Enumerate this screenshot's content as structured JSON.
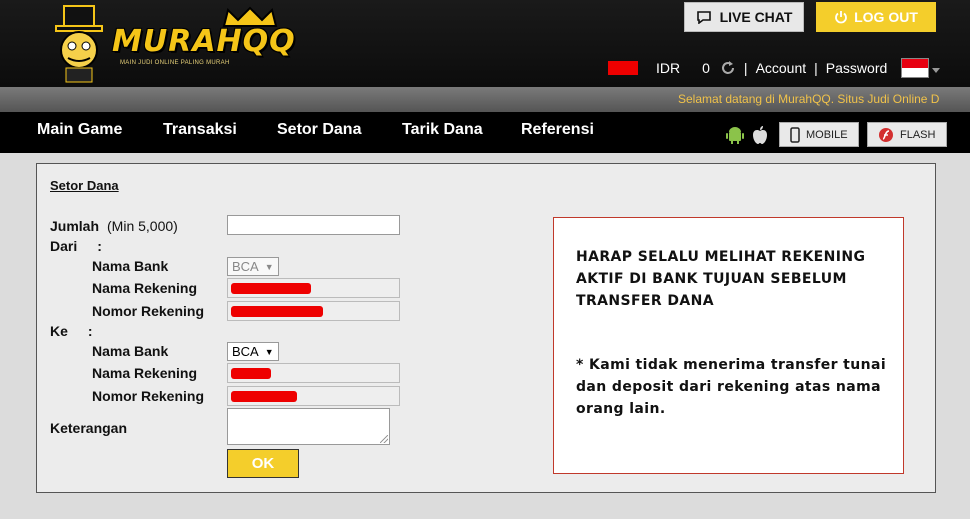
{
  "header": {
    "logo_text": "MURAHQQ",
    "logo_tagline": "MAIN JUDI ONLINE PALING MURAH",
    "live_chat_label": "LIVE CHAT",
    "logout_label": "LOG OUT",
    "currency": "IDR",
    "balance": "0",
    "account_link": "Account",
    "password_link": "Password",
    "separator": "|"
  },
  "marquee": {
    "text": "Selamat datang di MurahQQ. Situs Judi Online D"
  },
  "nav": {
    "items": [
      "Main Game",
      "Transaksi",
      "Setor Dana",
      "Tarik Dana",
      "Referensi"
    ],
    "mobile_label": "MOBILE",
    "flash_label": "FLASH"
  },
  "form": {
    "title": "Setor Dana",
    "jumlah_label": "Jumlah",
    "jumlah_min": "(Min 5,000)",
    "jumlah_value": "",
    "dari_label": "Dari",
    "ke_label": "Ke",
    "colon": ":",
    "nama_bank_label": "Nama Bank",
    "nama_rekening_label": "Nama Rekening",
    "nomor_rekening_label": "Nomor Rekening",
    "dari_bank": "BCA",
    "ke_bank": "BCA",
    "keterangan_label": "Keterangan",
    "ok_label": "OK"
  },
  "notice": {
    "line1": "HARAP SELALU MELIHAT REKENING AKTIF DI BANK TUJUAN SEBELUM TRANSFER DANA",
    "line2": "* Kami tidak menerima transfer tunai dan deposit dari rekening atas nama orang lain."
  },
  "colors": {
    "accent_yellow": "#f4ce2b",
    "nav_bg": "#000000",
    "notice_border": "#c0392b",
    "marquee_text": "#f0c24a"
  }
}
